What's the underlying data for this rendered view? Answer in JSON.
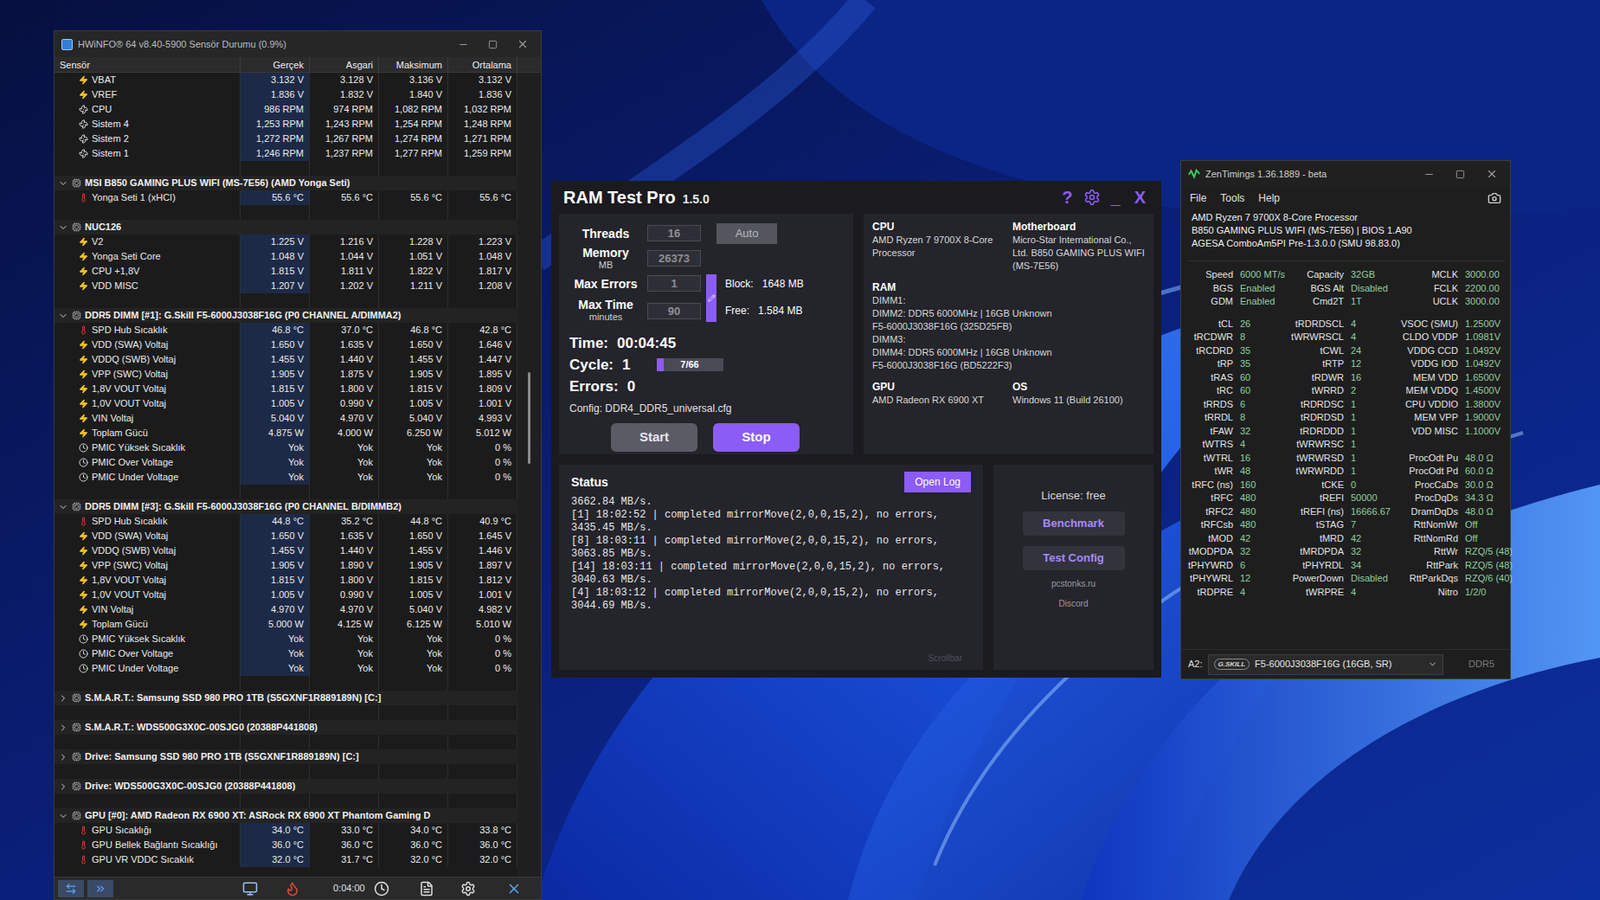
{
  "hwinfo": {
    "title": "HWiNFO® 64 v8.40-5900 Sensör Durumu (0.9%)",
    "columns": [
      "Sensör",
      "Gerçek",
      "Asgari",
      "Maksimum",
      "Ortalama"
    ],
    "rows": [
      {
        "kind": "sensor",
        "type": "voltage",
        "name": "VBAT",
        "values": [
          "3.132 V",
          "3.128 V",
          "3.136 V",
          "3.132 V"
        ]
      },
      {
        "kind": "sensor",
        "type": "voltage",
        "name": "VREF",
        "values": [
          "1.836 V",
          "1.832 V",
          "1.840 V",
          "1.836 V"
        ]
      },
      {
        "kind": "sensor",
        "type": "fan",
        "name": "CPU",
        "values": [
          "986 RPM",
          "974 RPM",
          "1,082 RPM",
          "1,032 RPM"
        ]
      },
      {
        "kind": "sensor",
        "type": "fan",
        "name": "Sistem 4",
        "values": [
          "1,253 RPM",
          "1,243 RPM",
          "1,254 RPM",
          "1,248 RPM"
        ]
      },
      {
        "kind": "sensor",
        "type": "fan",
        "name": "Sistem 2",
        "values": [
          "1,272 RPM",
          "1,267 RPM",
          "1,274 RPM",
          "1,271 RPM"
        ]
      },
      {
        "kind": "sensor",
        "type": "fan",
        "name": "Sistem 1",
        "values": [
          "1,246 RPM",
          "1,237 RPM",
          "1,277 RPM",
          "1,259 RPM"
        ]
      },
      {
        "kind": "spacer"
      },
      {
        "kind": "group",
        "label": "MSI B850 GAMING PLUS WIFI (MS-7E56) (AMD Yonga Seti)",
        "expanded": true
      },
      {
        "kind": "sensor",
        "type": "temp",
        "name": "Yonga Seti 1 (xHCI)",
        "values": [
          "55.6 °C",
          "55.6 °C",
          "55.6 °C",
          "55.6 °C"
        ]
      },
      {
        "kind": "spacer"
      },
      {
        "kind": "group",
        "label": "NUC126",
        "expanded": true
      },
      {
        "kind": "sensor",
        "type": "voltage",
        "name": "V2",
        "values": [
          "1.225 V",
          "1.216 V",
          "1.228 V",
          "1.223 V"
        ]
      },
      {
        "kind": "sensor",
        "type": "voltage",
        "name": "Yonga Seti Core",
        "values": [
          "1.048 V",
          "1.044 V",
          "1.051 V",
          "1.048 V"
        ]
      },
      {
        "kind": "sensor",
        "type": "voltage",
        "name": "CPU +1,8V",
        "values": [
          "1.815 V",
          "1.811 V",
          "1.822 V",
          "1.817 V"
        ]
      },
      {
        "kind": "sensor",
        "type": "voltage",
        "name": "VDD MISC",
        "values": [
          "1.207 V",
          "1.202 V",
          "1.211 V",
          "1.208 V"
        ]
      },
      {
        "kind": "spacer"
      },
      {
        "kind": "group",
        "label": "DDR5 DIMM [#1]: G.Skill F5-6000J3038F16G (P0 CHANNEL A/DIMMA2)",
        "expanded": true
      },
      {
        "kind": "sensor",
        "type": "temp",
        "name": "SPD Hub Sıcaklık",
        "values": [
          "46.8 °C",
          "37.0 °C",
          "46.8 °C",
          "42.8 °C"
        ]
      },
      {
        "kind": "sensor",
        "type": "voltage",
        "name": "VDD (SWA) Voltaj",
        "values": [
          "1.650 V",
          "1.635 V",
          "1.650 V",
          "1.646 V"
        ]
      },
      {
        "kind": "sensor",
        "type": "voltage",
        "name": "VDDQ (SWB) Voltaj",
        "values": [
          "1.455 V",
          "1.440 V",
          "1.455 V",
          "1.447 V"
        ]
      },
      {
        "kind": "sensor",
        "type": "voltage",
        "name": "VPP (SWC) Voltaj",
        "values": [
          "1.905 V",
          "1.875 V",
          "1.905 V",
          "1.895 V"
        ]
      },
      {
        "kind": "sensor",
        "type": "voltage",
        "name": "1,8V VOUT Voltaj",
        "values": [
          "1.815 V",
          "1.800 V",
          "1.815 V",
          "1.809 V"
        ]
      },
      {
        "kind": "sensor",
        "type": "voltage",
        "name": "1,0V VOUT Voltaj",
        "values": [
          "1.005 V",
          "0.990 V",
          "1.005 V",
          "1.001 V"
        ]
      },
      {
        "kind": "sensor",
        "type": "voltage",
        "name": "VIN Voltaj",
        "values": [
          "5.040 V",
          "4.970 V",
          "5.040 V",
          "4.993 V"
        ]
      },
      {
        "kind": "sensor",
        "type": "voltage",
        "name": "Toplam Gücü",
        "values": [
          "4.875 W",
          "4.000 W",
          "6.250 W",
          "5.012 W"
        ]
      },
      {
        "kind": "sensor",
        "type": "clock",
        "name": "PMIC Yüksek Sıcaklık",
        "values": [
          "Yok",
          "Yok",
          "Yok",
          "0 %"
        ]
      },
      {
        "kind": "sensor",
        "type": "clock",
        "name": "PMIC Over Voltage",
        "values": [
          "Yok",
          "Yok",
          "Yok",
          "0 %"
        ]
      },
      {
        "kind": "sensor",
        "type": "clock",
        "name": "PMIC Under Voltage",
        "values": [
          "Yok",
          "Yok",
          "Yok",
          "0 %"
        ]
      },
      {
        "kind": "spacer"
      },
      {
        "kind": "group",
        "label": "DDR5 DIMM [#3]: G.Skill F5-6000J3038F16G (P0 CHANNEL B/DIMMB2)",
        "expanded": true
      },
      {
        "kind": "sensor",
        "type": "temp",
        "name": "SPD Hub Sıcaklık",
        "values": [
          "44.8 °C",
          "35.2 °C",
          "44.8 °C",
          "40.9 °C"
        ]
      },
      {
        "kind": "sensor",
        "type": "voltage",
        "name": "VDD (SWA) Voltaj",
        "values": [
          "1.650 V",
          "1.635 V",
          "1.650 V",
          "1.645 V"
        ]
      },
      {
        "kind": "sensor",
        "type": "voltage",
        "name": "VDDQ (SWB) Voltaj",
        "values": [
          "1.455 V",
          "1.440 V",
          "1.455 V",
          "1.446 V"
        ]
      },
      {
        "kind": "sensor",
        "type": "voltage",
        "name": "VPP (SWC) Voltaj",
        "values": [
          "1.905 V",
          "1.890 V",
          "1.905 V",
          "1.897 V"
        ]
      },
      {
        "kind": "sensor",
        "type": "voltage",
        "name": "1,8V VOUT Voltaj",
        "values": [
          "1.815 V",
          "1.800 V",
          "1.815 V",
          "1.812 V"
        ]
      },
      {
        "kind": "sensor",
        "type": "voltage",
        "name": "1,0V VOUT Voltaj",
        "values": [
          "1.005 V",
          "0.990 V",
          "1.005 V",
          "1.001 V"
        ]
      },
      {
        "kind": "sensor",
        "type": "voltage",
        "name": "VIN Voltaj",
        "values": [
          "4.970 V",
          "4.970 V",
          "5.040 V",
          "4.982 V"
        ]
      },
      {
        "kind": "sensor",
        "type": "voltage",
        "name": "Toplam Gücü",
        "values": [
          "5.000 W",
          "4.125 W",
          "6.125 W",
          "5.010 W"
        ]
      },
      {
        "kind": "sensor",
        "type": "clock",
        "name": "PMIC Yüksek Sıcaklık",
        "values": [
          "Yok",
          "Yok",
          "Yok",
          "0 %"
        ]
      },
      {
        "kind": "sensor",
        "type": "clock",
        "name": "PMIC Over Voltage",
        "values": [
          "Yok",
          "Yok",
          "Yok",
          "0 %"
        ]
      },
      {
        "kind": "sensor",
        "type": "clock",
        "name": "PMIC Under Voltage",
        "values": [
          "Yok",
          "Yok",
          "Yok",
          "0 %"
        ]
      },
      {
        "kind": "spacer"
      },
      {
        "kind": "group",
        "label": "S.M.A.R.T.: Samsung SSD 980 PRO 1TB (S5GXNF1R889189N) [C:]",
        "expanded": false
      },
      {
        "kind": "spacer"
      },
      {
        "kind": "group",
        "label": "S.M.A.R.T.: WDS500G3X0C-00SJG0 (20388P441808)",
        "expanded": false
      },
      {
        "kind": "spacer"
      },
      {
        "kind": "group",
        "label": "Drive: Samsung SSD 980 PRO 1TB (S5GXNF1R889189N) [C:]",
        "expanded": false
      },
      {
        "kind": "spacer"
      },
      {
        "kind": "group",
        "label": "Drive: WDS500G3X0C-00SJG0 (20388P441808)",
        "expanded": false
      },
      {
        "kind": "spacer"
      },
      {
        "kind": "group",
        "label": "GPU [#0]: AMD Radeon RX 6900 XT: ASRock RX 6900 XT Phantom Gaming D",
        "expanded": true
      },
      {
        "kind": "sensor",
        "type": "temp",
        "name": "GPU Sıcaklığı",
        "values": [
          "34.0 °C",
          "33.0 °C",
          "34.0 °C",
          "33.8 °C"
        ]
      },
      {
        "kind": "sensor",
        "type": "temp",
        "name": "GPU Bellek Bağlantı Sıcaklığı",
        "values": [
          "36.0 °C",
          "36.0 °C",
          "36.0 °C",
          "36.0 °C"
        ]
      },
      {
        "kind": "sensor",
        "type": "temp",
        "name": "GPU VR VDDC Sıcaklık",
        "values": [
          "32.0 °C",
          "31.7 °C",
          "32.0 °C",
          "32.0 °C"
        ]
      }
    ],
    "toolbar": {
      "timer": "0:04:00"
    }
  },
  "ramtest": {
    "title": "RAM Test Pro",
    "version": "1.5.0",
    "header_glyphs": {
      "help": "?",
      "minimize": "_",
      "close": "X"
    },
    "settings": [
      {
        "label": "Threads",
        "value": "16"
      },
      {
        "label": "Memory",
        "sublabel": "MB",
        "value": "26373"
      },
      {
        "label": "Max Errors",
        "value": "1"
      },
      {
        "label": "Max Time",
        "sublabel": "minutes",
        "value": "90"
      }
    ],
    "auto_button": "Auto",
    "block": {
      "label": "Block:",
      "value": "1648 MB"
    },
    "free": {
      "label": "Free:",
      "value": "1.584 MB"
    },
    "time": {
      "label": "Time:",
      "value": "00:04:45"
    },
    "cycle": {
      "label": "Cycle:",
      "value": "1",
      "progress_text": "7/66",
      "level": 0.106
    },
    "errors": {
      "label": "Errors:",
      "value": "0"
    },
    "config": "Config: DDR4_DDR5_universal.cfg",
    "buttons": {
      "start": "Start",
      "stop": "Stop"
    },
    "system": {
      "cpu": {
        "label": "CPU",
        "value": "AMD Ryzen 7 9700X 8-Core Processor"
      },
      "motherboard": {
        "label": "Motherboard",
        "value": "Micro-Star International Co., Ltd. B850 GAMING PLUS WIFI (MS-7E56)"
      },
      "ram": {
        "label": "RAM",
        "lines": [
          "DIMM1:",
          "DIMM2: DDR5 6000MHz | 16GB Unknown",
          "F5-6000J3038F16G (325D25FB)",
          "DIMM3:",
          "DIMM4: DDR5 6000MHz | 16GB Unknown",
          "F5-6000J3038F16G (BD5222F3)"
        ]
      },
      "gpu": {
        "label": "GPU",
        "value": "AMD Radeon RX 6900 XT"
      },
      "os": {
        "label": "OS",
        "value": "Windows 11 (Build 26100)"
      }
    },
    "status": {
      "title": "Status",
      "open_log": "Open Log",
      "lines": [
        "3662.84 MB/s.",
        "[1] 18:02:52 | completed mirrorMove(2,0,0,15,2), no errors,",
        "3435.45 MB/s.",
        "[8] 18:03:11 | completed mirrorMove(2,0,0,15,2), no errors,",
        "3063.85 MB/s.",
        "[14] 18:03:11 | completed mirrorMove(2,0,0,15,2), no errors,",
        "3040.63 MB/s.",
        "[4] 18:03:12 | completed mirrorMove(2,0,0,15,2), no errors,",
        "3044.69 MB/s."
      ],
      "scrollbar": "Scrollbar"
    },
    "side": {
      "license": "License: free",
      "benchmark": "Benchmark",
      "test_config": "Test Config",
      "links": [
        "pcstonks.ru",
        "Discord"
      ]
    }
  },
  "zentimings": {
    "title": "ZenTimings 1.36.1889 - beta",
    "menu": [
      "File",
      "Tools",
      "Help"
    ],
    "info": [
      "AMD Ryzen 7 9700X 8-Core Processor",
      "B850 GAMING PLUS WIFI (MS-7E56) | BIOS 1.A90",
      "AGESA ComboAm5PI Pre-1.3.0.0 (SMU 98.83.0)"
    ],
    "sections": [
      {
        "rows": [
          [
            {
              "label": "Speed",
              "value": "6000 MT/s"
            },
            {
              "label": "Capacity",
              "value": "32GB"
            },
            {
              "label": "MCLK",
              "value": "3000.00"
            }
          ],
          [
            {
              "label": "BGS",
              "value": "Enabled"
            },
            {
              "label": "BGS Alt",
              "value": "Disabled"
            },
            {
              "label": "FCLK",
              "value": "2200.00"
            }
          ],
          [
            {
              "label": "GDM",
              "value": "Enabled"
            },
            {
              "label": "Cmd2T",
              "value": "1T"
            },
            {
              "label": "UCLK",
              "value": "3000.00"
            }
          ]
        ]
      },
      {
        "rows": [
          [
            {
              "label": "tCL",
              "value": "26"
            },
            {
              "label": "tRDRDSCL",
              "value": "4"
            },
            {
              "label": "VSOC (SMU)",
              "value": "1.2500V"
            }
          ],
          [
            {
              "label": "tRCDWR",
              "value": "8"
            },
            {
              "label": "tWRWRSCL",
              "value": "4"
            },
            {
              "label": "CLDO VDDP",
              "value": "1.0981V"
            }
          ],
          [
            {
              "label": "tRCDRD",
              "value": "35"
            },
            {
              "label": "tCWL",
              "value": "24"
            },
            {
              "label": "VDDG CCD",
              "value": "1.0492V"
            }
          ],
          [
            {
              "label": "tRP",
              "value": "35"
            },
            {
              "label": "tRTP",
              "value": "12"
            },
            {
              "label": "VDDG IOD",
              "value": "1.0492V"
            }
          ],
          [
            {
              "label": "tRAS",
              "value": "60"
            },
            {
              "label": "tRDWR",
              "value": "16"
            },
            {
              "label": "MEM VDD",
              "value": "1.6500V"
            }
          ],
          [
            {
              "label": "tRC",
              "value": "60"
            },
            {
              "label": "tWRRD",
              "value": "2"
            },
            {
              "label": "MEM VDDQ",
              "value": "1.4500V"
            }
          ],
          [
            {
              "label": "tRRDS",
              "value": "6"
            },
            {
              "label": "tRDRDSC",
              "value": "1"
            },
            {
              "label": "CPU VDDIO",
              "value": "1.3800V"
            }
          ],
          [
            {
              "label": "tRRDL",
              "value": "8"
            },
            {
              "label": "tRDRDSD",
              "value": "1"
            },
            {
              "label": "MEM VPP",
              "value": "1.9000V"
            }
          ],
          [
            {
              "label": "tFAW",
              "value": "32"
            },
            {
              "label": "tRDRDDD",
              "value": "1"
            },
            {
              "label": "VDD MISC",
              "value": "1.1000V"
            }
          ],
          [
            {
              "label": "tWTRS",
              "value": "4"
            },
            {
              "label": "tWRWRSC",
              "value": "1"
            }
          ],
          [
            {
              "label": "tWTRL",
              "value": "16"
            },
            {
              "label": "tWRWRSD",
              "value": "1"
            },
            {
              "label": "ProcOdt Pu",
              "value": "48.0 Ω"
            }
          ],
          [
            {
              "label": "tWR",
              "value": "48"
            },
            {
              "label": "tWRWRDD",
              "value": "1"
            },
            {
              "label": "ProcOdt Pd",
              "value": "60.0 Ω"
            }
          ],
          [
            {
              "label": "tRFC (ns)",
              "value": "160"
            },
            {
              "label": "tCKE",
              "value": "0"
            },
            {
              "label": "ProcCaDs",
              "value": "30.0 Ω"
            }
          ],
          [
            {
              "label": "tRFC",
              "value": "480"
            },
            {
              "label": "tREFI",
              "value": "50000"
            },
            {
              "label": "ProcDqDs",
              "value": "34.3 Ω"
            }
          ],
          [
            {
              "label": "tRFC2",
              "value": "480"
            },
            {
              "label": "tREFI (ns)",
              "value": "16666.67"
            },
            {
              "label": "DramDqDs",
              "value": "48.0 Ω"
            }
          ],
          [
            {
              "label": "tRFCsb",
              "value": "480"
            },
            {
              "label": "tSTAG",
              "value": "7"
            },
            {
              "label": "RttNomWr",
              "value": "Off"
            }
          ],
          [
            {
              "label": "tMOD",
              "value": "42"
            },
            {
              "label": "tMRD",
              "value": "42"
            },
            {
              "label": "RttNomRd",
              "value": "Off"
            }
          ],
          [
            {
              "label": "tMODPDA",
              "value": "32"
            },
            {
              "label": "tMRDPDA",
              "value": "32"
            },
            {
              "label": "RttWr",
              "value": "RZQ/5 (48)"
            }
          ],
          [
            {
              "label": "tPHYWRD",
              "value": "6"
            },
            {
              "label": "tPHYRDL",
              "value": "34"
            },
            {
              "label": "RttPark",
              "value": "RZQ/5 (48)"
            }
          ],
          [
            {
              "label": "tPHYWRL",
              "value": "12"
            },
            {
              "label": "PowerDown",
              "value": "Disabled"
            },
            {
              "label": "RttParkDqs",
              "value": "RZQ/6 (40)"
            }
          ],
          [
            {
              "label": "tRDPRE",
              "value": "4"
            },
            {
              "label": "tWRPRE",
              "value": "4"
            },
            {
              "label": "Nitro",
              "value": "1/2/0"
            }
          ]
        ]
      }
    ],
    "module": {
      "slot": "A2:",
      "logo": "G.SKILL",
      "name": "F5-6000J3038F16G (16GB, SR)",
      "type": "DDR5"
    }
  }
}
